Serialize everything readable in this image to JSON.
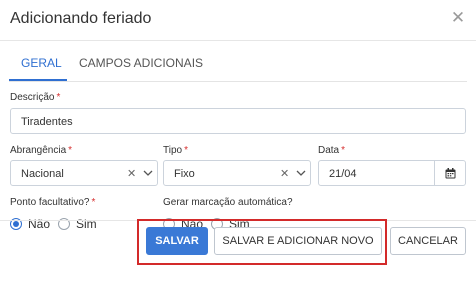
{
  "dialog": {
    "title": "Adicionando feriado",
    "close_icon": "close-icon"
  },
  "tabs": [
    {
      "label": "GERAL",
      "active": true
    },
    {
      "label": "CAMPOS ADICIONAIS",
      "active": false
    }
  ],
  "fields": {
    "descricao": {
      "label": "Descrição",
      "required": "*",
      "value": "Tiradentes"
    },
    "abrangencia": {
      "label": "Abrangência",
      "required": "*",
      "value": "Nacional",
      "clear_icon": "clear-icon",
      "caret_icon": "chevron-down-icon"
    },
    "tipo": {
      "label": "Tipo",
      "required": "*",
      "value": "Fixo",
      "clear_icon": "clear-icon",
      "caret_icon": "chevron-down-icon"
    },
    "data": {
      "label": "Data",
      "required": "*",
      "value": "21/04",
      "icon": "calendar-icon"
    }
  },
  "ponto_facultativo": {
    "label": "Ponto facultativo?",
    "required": "*",
    "options": [
      {
        "label": "Não",
        "checked": true
      },
      {
        "label": "Sim",
        "checked": false
      }
    ]
  },
  "gerar_marcacao": {
    "label": "Gerar marcação automática?",
    "options": [
      {
        "label": "Não",
        "checked": false
      },
      {
        "label": "Sim",
        "checked": false
      }
    ]
  },
  "buttons": {
    "save": "SALVAR",
    "save_new": "SALVAR E ADICIONAR NOVO",
    "cancel": "CANCELAR"
  },
  "colors": {
    "accent": "#2f6fd1",
    "required": "#d62e2e",
    "highlight": "#d32a2a"
  }
}
